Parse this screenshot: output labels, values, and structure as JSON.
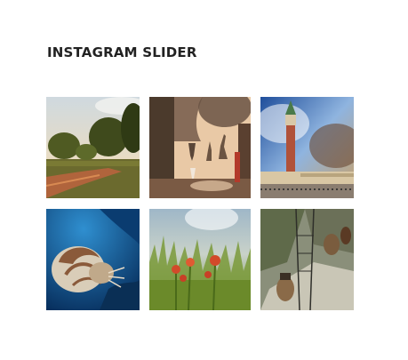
{
  "widget": {
    "title": "INSTAGRAM SLIDER",
    "posts": [
      {
        "subject": "countryside dirt road with trees at sunset"
      },
      {
        "subject": "shadow of a wine glass and giraffe figurines on a wall"
      },
      {
        "subject": "Venice bell tower under a dramatic sky"
      },
      {
        "subject": "nautilus swimming in deep blue water"
      },
      {
        "subject": "red flowers in misty grass"
      },
      {
        "subject": "hiker boots on a rope bridge above rocks"
      }
    ]
  }
}
